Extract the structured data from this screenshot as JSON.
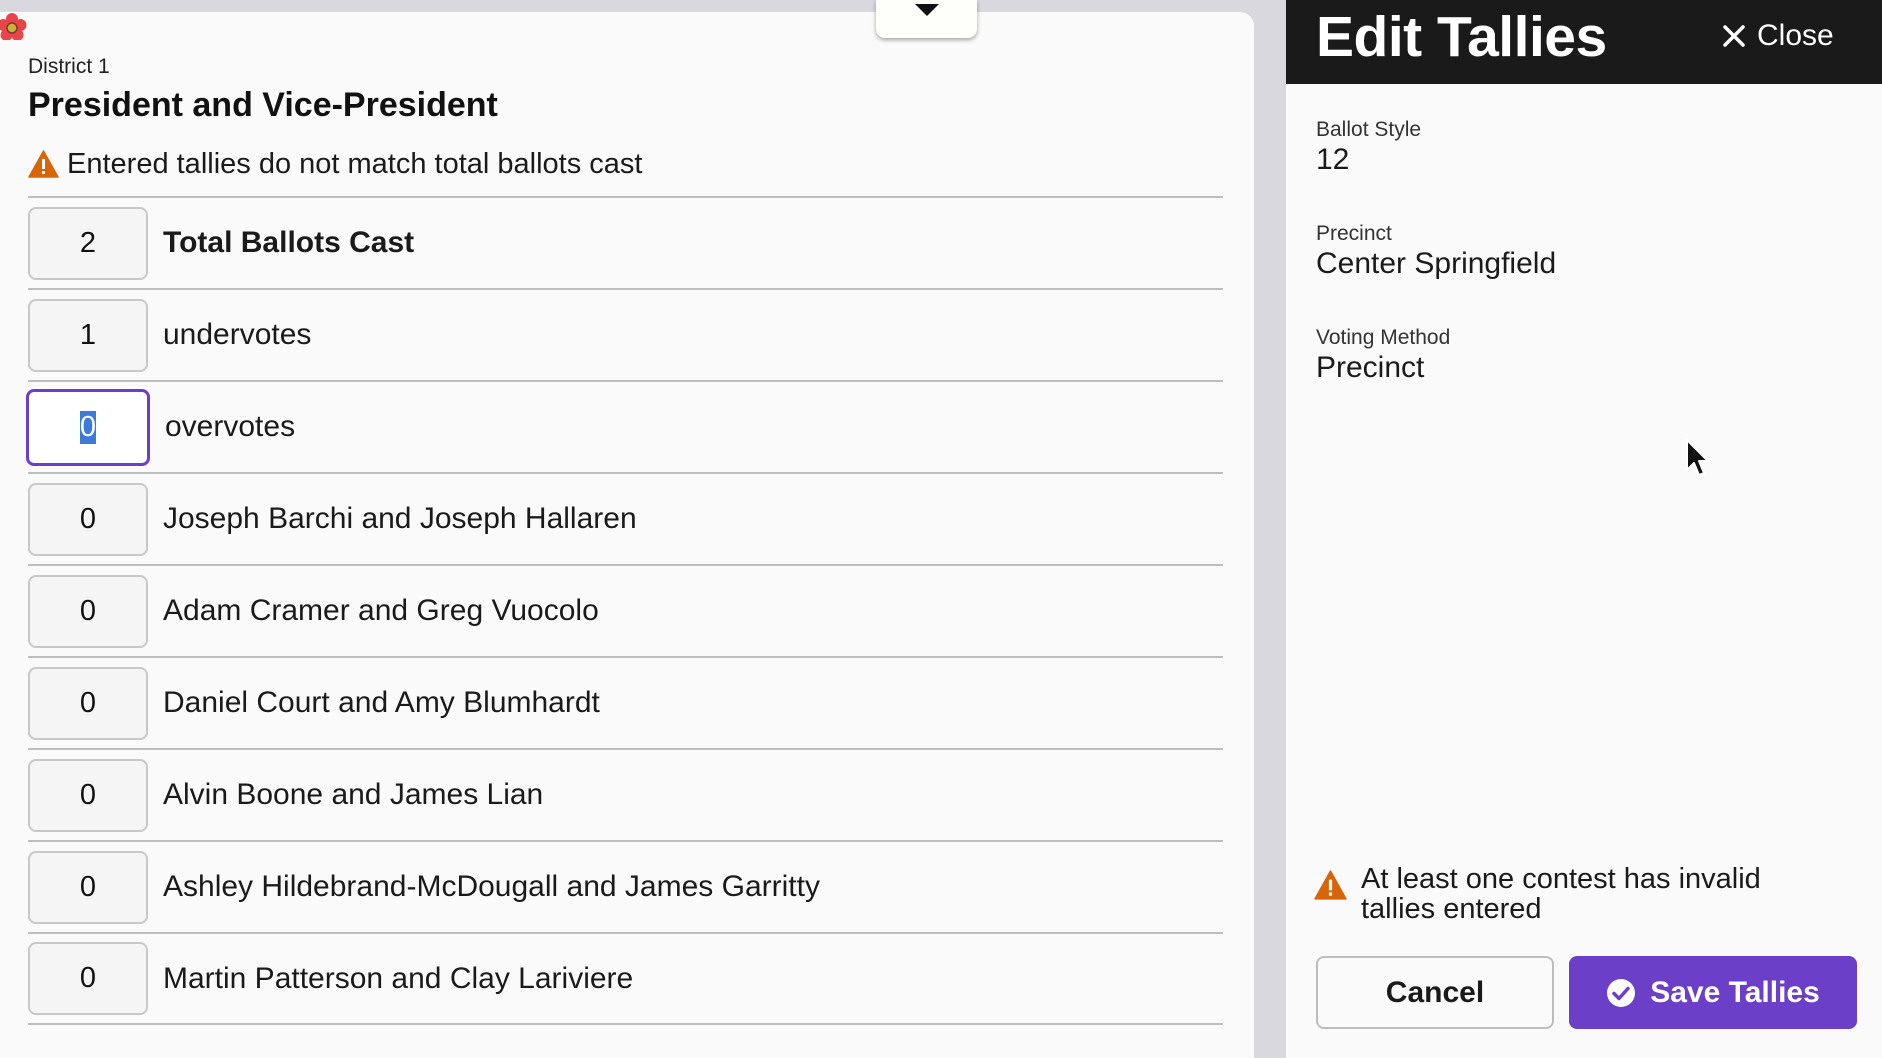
{
  "form": {
    "district": "District 1",
    "contest_title": "President and Vice-President",
    "warning": "Entered tallies do not match total ballots cast",
    "rows": [
      {
        "value": "2",
        "label": "Total Ballots Cast"
      },
      {
        "value": "1",
        "label": "undervotes"
      },
      {
        "value": "0",
        "label": "overvotes"
      },
      {
        "value": "0",
        "label": "Joseph Barchi and Joseph Hallaren"
      },
      {
        "value": "0",
        "label": "Adam Cramer and Greg Vuocolo"
      },
      {
        "value": "0",
        "label": "Daniel Court and Amy Blumhardt"
      },
      {
        "value": "0",
        "label": "Alvin Boone and James Lian"
      },
      {
        "value": "0",
        "label": "Ashley Hildebrand-McDougall and James Garritty"
      },
      {
        "value": "0",
        "label": "Martin Patterson and Clay Lariviere"
      }
    ]
  },
  "panel": {
    "title": "Edit Tallies",
    "close_label": "Close",
    "ballot_style_label": "Ballot Style",
    "ballot_style_value": "12",
    "precinct_label": "Precinct",
    "precinct_value": "Center Springfield",
    "voting_method_label": "Voting Method",
    "voting_method_value": "Precinct",
    "warning": "At least one contest has invalid tallies entered",
    "cancel_label": "Cancel",
    "save_label": "Save Tallies"
  },
  "colors": {
    "accent": "#6c3fc8",
    "warning": "#d9650a",
    "header_bg": "#1a1a1a"
  },
  "icons": [
    "flower-logo-icon",
    "caret-down-icon",
    "warning-icon",
    "close-icon",
    "check-circle-icon",
    "mouse-cursor-icon"
  ]
}
